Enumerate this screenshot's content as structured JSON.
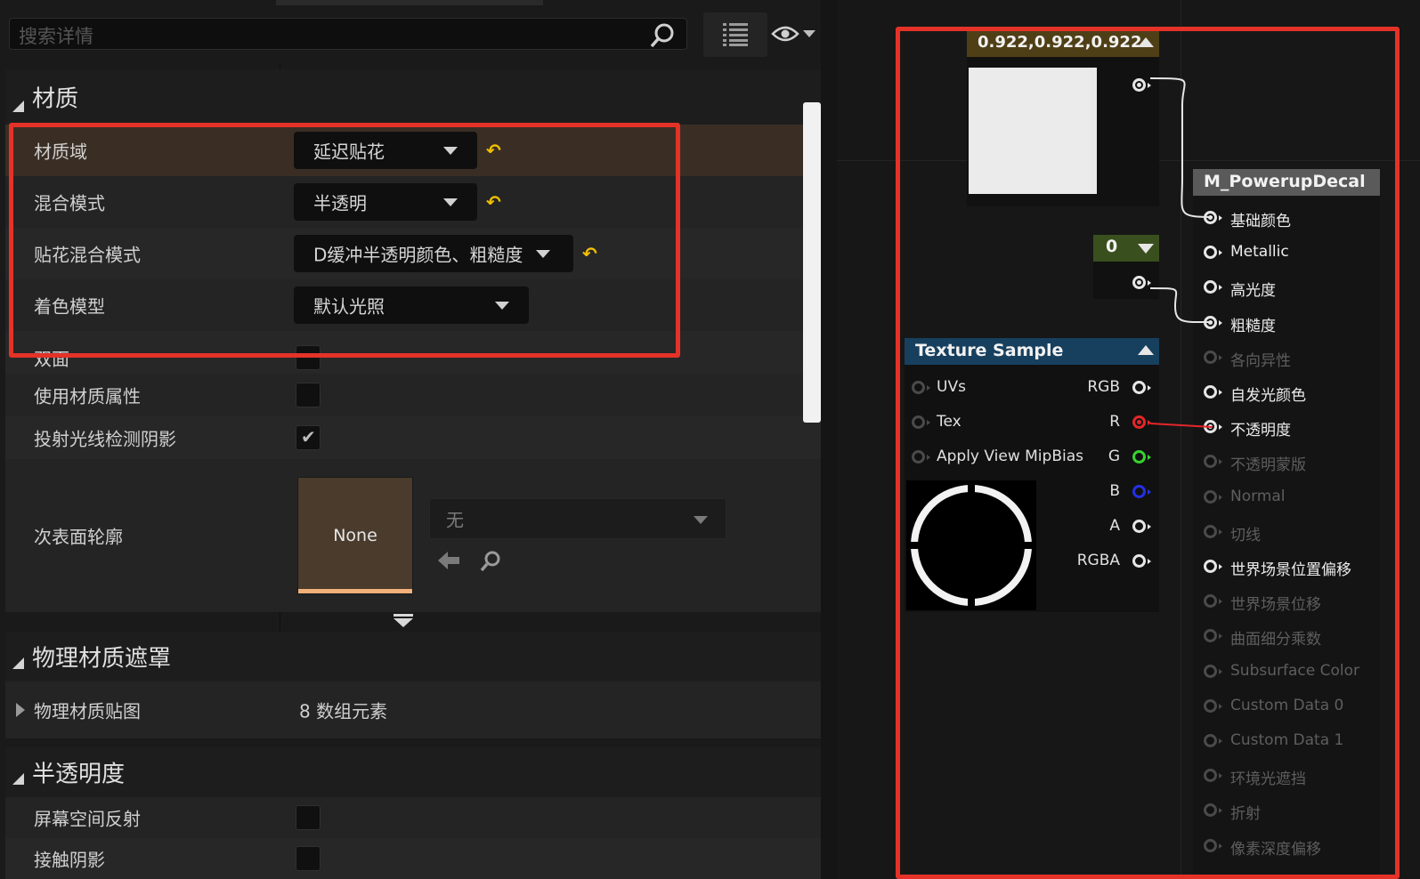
{
  "details": {
    "search_placeholder": "搜索详情",
    "categories": {
      "material": "材质",
      "phys_mask": "物理材质遮罩",
      "translucency": "半透明度"
    },
    "rows": {
      "material_domain": {
        "label": "材质域",
        "value": "延迟贴花"
      },
      "blend_mode": {
        "label": "混合模式",
        "value": "半透明"
      },
      "decal_blend_mode": {
        "label": "贴花混合模式",
        "value": "D缓冲半透明颜色、粗糙度"
      },
      "shading_model": {
        "label": "着色模型",
        "value": "默认光照"
      },
      "two_sided": {
        "label": "双面",
        "checked": false
      },
      "use_material_attributes": {
        "label": "使用材质属性",
        "checked": false
      },
      "cast_ray_traced_shadows": {
        "label": "投射光线检测阴影",
        "checked": true
      },
      "subsurface_profile": {
        "label": "次表面轮廓",
        "thumb_text": "None",
        "asset_value": "无"
      },
      "phys_material_map": {
        "label": "物理材质贴图",
        "value": "8 数组元素"
      },
      "screen_space_reflections": {
        "label": "屏幕空间反射",
        "checked": false
      },
      "contact_shadows": {
        "label": "接触阴影",
        "checked": false
      }
    },
    "reset_icon": "↶"
  },
  "graph": {
    "constant_node": {
      "value": "0.922,0.922,0.922",
      "color": "#ebebeb"
    },
    "scalar_node": {
      "value": "0"
    },
    "texture_node": {
      "title": "Texture Sample",
      "inputs": [
        "UVs",
        "Tex",
        "Apply View MipBias"
      ],
      "outputs": [
        "RGB",
        "R",
        "G",
        "B",
        "A",
        "RGBA"
      ]
    },
    "material_node": {
      "title": "M_PowerupDecal",
      "inputs": [
        {
          "label": "基础颜色",
          "active": true,
          "connected": true
        },
        {
          "label": "Metallic",
          "active": true,
          "connected": false
        },
        {
          "label": "高光度",
          "active": true,
          "connected": false
        },
        {
          "label": "粗糙度",
          "active": true,
          "connected": true
        },
        {
          "label": "各向异性",
          "active": false,
          "connected": false
        },
        {
          "label": "自发光颜色",
          "active": true,
          "connected": false
        },
        {
          "label": "不透明度",
          "active": true,
          "connected": true
        },
        {
          "label": "不透明蒙版",
          "active": false,
          "connected": false
        },
        {
          "label": "Normal",
          "active": false,
          "connected": false
        },
        {
          "label": "切线",
          "active": false,
          "connected": false
        },
        {
          "label": "世界场景位置偏移",
          "active": true,
          "connected": false
        },
        {
          "label": "世界场景位移",
          "active": false,
          "connected": false
        },
        {
          "label": "曲面细分乘数",
          "active": false,
          "connected": false
        },
        {
          "label": "Subsurface Color",
          "active": false,
          "connected": false
        },
        {
          "label": "Custom Data 0",
          "active": false,
          "connected": false
        },
        {
          "label": "Custom Data 1",
          "active": false,
          "connected": false
        },
        {
          "label": "环境光遮挡",
          "active": false,
          "connected": false
        },
        {
          "label": "折射",
          "active": false,
          "connected": false
        },
        {
          "label": "像素深度偏移",
          "active": false,
          "connected": false
        }
      ]
    }
  },
  "colors": {
    "highlight_box": "#e53228",
    "reset_accent": "#f0c000",
    "pin_red": "#e4262a",
    "pin_green": "#38d22f",
    "pin_blue": "#2430e4"
  }
}
